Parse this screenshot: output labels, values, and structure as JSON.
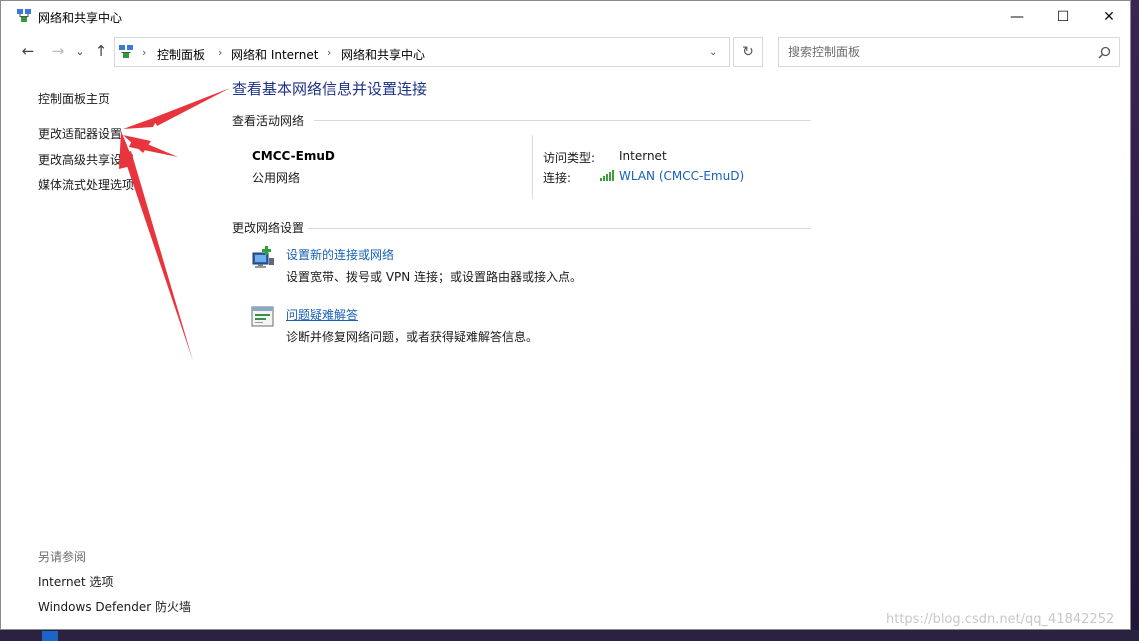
{
  "window": {
    "title": "网络和共享中心"
  },
  "title_controls": {
    "minimize": "—",
    "maximize": "☐",
    "close": "✕"
  },
  "nav": {
    "back": "←",
    "forward": "→",
    "recent": "⌄",
    "up": "↑"
  },
  "breadcrumb": [
    "控制面板",
    "网络和 Internet",
    "网络和共享中心"
  ],
  "breadcrumb_separator": "›",
  "address_dropdown": "⌄",
  "refresh": "↻",
  "search": {
    "placeholder": "搜索控制面板"
  },
  "sidebar": {
    "items": [
      {
        "label": "控制面板主页"
      },
      {
        "label": "更改适配器设置"
      },
      {
        "label": "更改高级共享设置"
      },
      {
        "label": "媒体流式处理选项"
      }
    ],
    "see_also_title": "另请参阅",
    "see_also": [
      {
        "label": "Internet 选项"
      },
      {
        "label": "Windows Defender 防火墙"
      }
    ]
  },
  "main": {
    "title": "查看基本网络信息并设置连接",
    "active_section": "查看活动网络",
    "network": {
      "name": "CMCC-EmuD",
      "type": "公用网络",
      "access_label": "访问类型:",
      "access_value": "Internet",
      "connection_label": "连接:",
      "connection_value": "WLAN (CMCC-EmuD)"
    },
    "change_section": "更改网络设置",
    "tasks": [
      {
        "title": "设置新的连接或网络",
        "desc": "设置宽带、拨号或 VPN 连接；或设置路由器或接入点。",
        "icon": "new-connection-icon"
      },
      {
        "title": "问题疑难解答",
        "desc": "诊断并修复网络问题，或者获得疑难解答信息。",
        "icon": "troubleshoot-icon"
      }
    ]
  },
  "watermark": "https://blog.csdn.net/qq_41842252",
  "colors": {
    "link": "#1660b9",
    "title": "#1e3287",
    "annotation_arrow": "#e8343c"
  }
}
